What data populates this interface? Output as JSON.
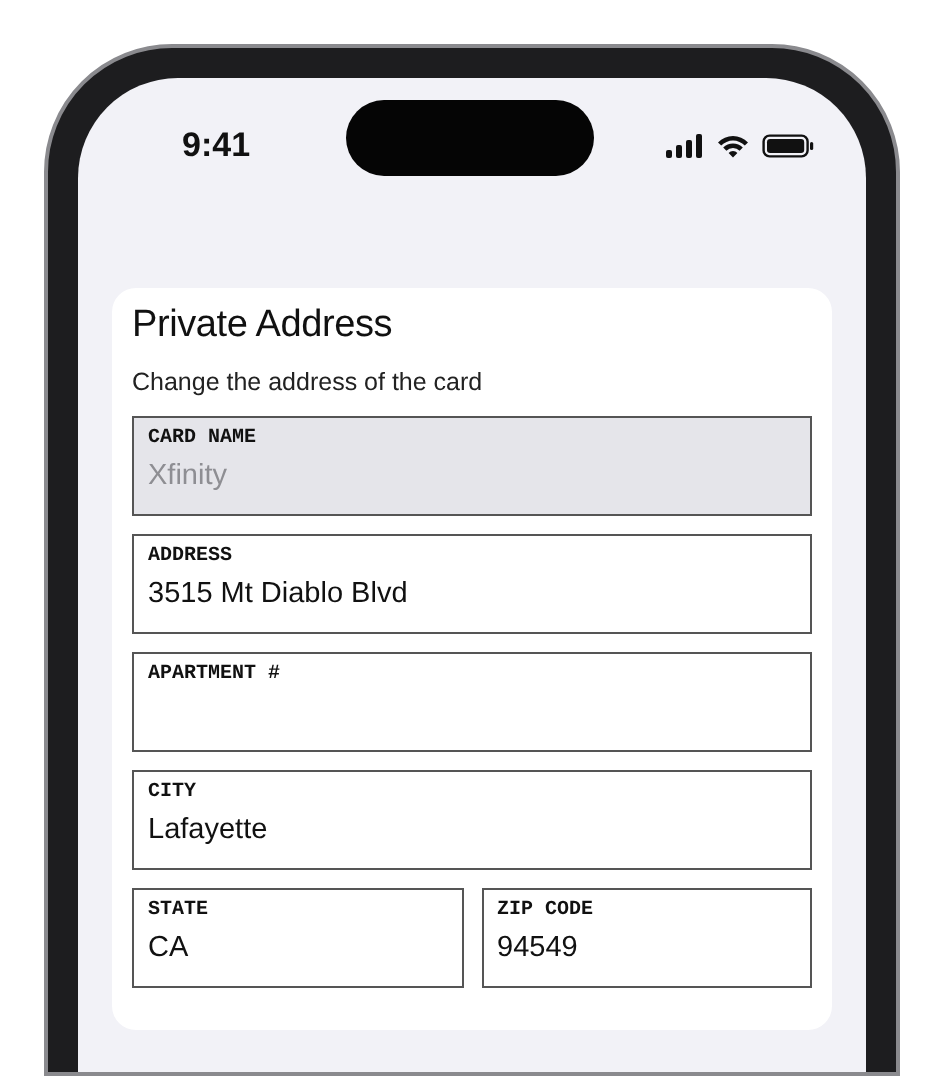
{
  "status_bar": {
    "time": "9:41"
  },
  "card": {
    "title": "Private Address",
    "subtitle": "Change the address of the card",
    "rows": [
      [
        {
          "label": "CARD NAME",
          "value": "Xfinity",
          "disabled": true
        }
      ],
      [
        {
          "label": "ADDRESS",
          "value": "3515 Mt Diablo Blvd",
          "disabled": false
        }
      ],
      [
        {
          "label": "APARTMENT #",
          "disabled": false
        }
      ],
      [
        {
          "label": "CITY",
          "value": "Lafayette",
          "disabled": false
        }
      ],
      [
        {
          "label": "STATE",
          "value": "CA",
          "disabled": false
        },
        {
          "label": "ZIP CODE",
          "value": "94549",
          "disabled": false
        }
      ]
    ]
  }
}
